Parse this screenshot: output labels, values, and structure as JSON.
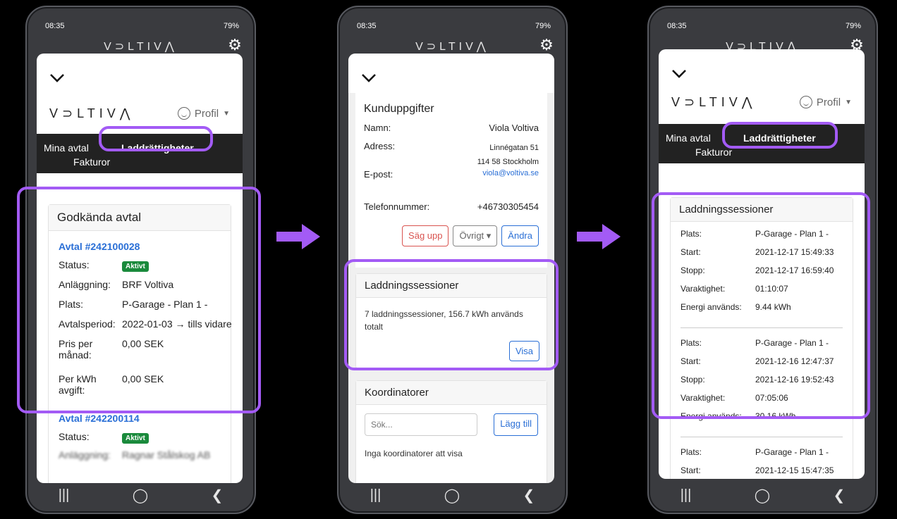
{
  "status": {
    "time": "08:35",
    "battery": "79%"
  },
  "brand": "V⊃LTIV⋀",
  "profile_label": "Profil",
  "tabs": {
    "agreements": "Mina avtal",
    "charging_rights": "Laddrättigheter",
    "invoices": "Fakturor"
  },
  "panel1": {
    "title": "Godkända avtal",
    "contract1": {
      "id": "Avtal #242100028",
      "status_label": "Status:",
      "status": "Aktivt",
      "facility_label": "Anläggning:",
      "facility": "BRF Voltiva",
      "location_label": "Plats:",
      "location": "P-Garage - Plan 1 -",
      "period_label": "Avtalsperiod:",
      "period": "2022-01-03 → tills vidare",
      "price_label": "Pris per månad:",
      "price": "0,00 SEK",
      "kwh_label": "Per kWh avgift:",
      "kwh": "0,00 SEK"
    },
    "contract2": {
      "id": "Avtal #242200114",
      "status_label": "Status:",
      "status": "Aktivt",
      "facility_label": "Anläggning:",
      "facility": "Ragnar Stålskog AB"
    }
  },
  "panel2": {
    "customer_title": "Kunduppgifter",
    "name_label": "Namn:",
    "name": "Viola Voltiva",
    "address_label": "Adress:",
    "address1": "Linnégatan 51",
    "address2": "114 58 Stockholm",
    "email_label": "E-post:",
    "email": "viola@voltiva.se",
    "phone_label": "Telefonnummer:",
    "phone": "+46730305454",
    "btn_cancel": "Säg upp",
    "btn_other": "Övrigt",
    "btn_edit": "Ändra",
    "sessions_title": "Laddningssessioner",
    "sessions_summary": "7 laddningssessioner, 156.7 kWh används totalt",
    "btn_show": "Visa",
    "coord_title": "Koordinatorer",
    "search_placeholder": "Sök...",
    "btn_add": "Lägg till",
    "coord_empty": "Inga koordinatorer att visa"
  },
  "panel3": {
    "title": "Laddningssessioner",
    "labels": {
      "place": "Plats:",
      "start": "Start:",
      "stop": "Stopp:",
      "duration": "Varaktighet:",
      "energy": "Energi används:"
    },
    "sessions": [
      {
        "place": "P-Garage - Plan 1 -",
        "start": "2021-12-17 15:49:33",
        "stop": "2021-12-17 16:59:40",
        "duration": "01:10:07",
        "energy": "9.44 kWh"
      },
      {
        "place": "P-Garage - Plan 1 -",
        "start": "2021-12-16 12:47:37",
        "stop": "2021-12-16 19:52:43",
        "duration": "07:05:06",
        "energy": "30.16 kWh"
      },
      {
        "place": "P-Garage - Plan 1 -",
        "start": "2021-12-15 15:47:35"
      }
    ]
  },
  "colors": {
    "highlight": "#a35bf5",
    "link": "#2a6fd6",
    "badge": "#1a8a3c",
    "navbar": "#222222"
  }
}
